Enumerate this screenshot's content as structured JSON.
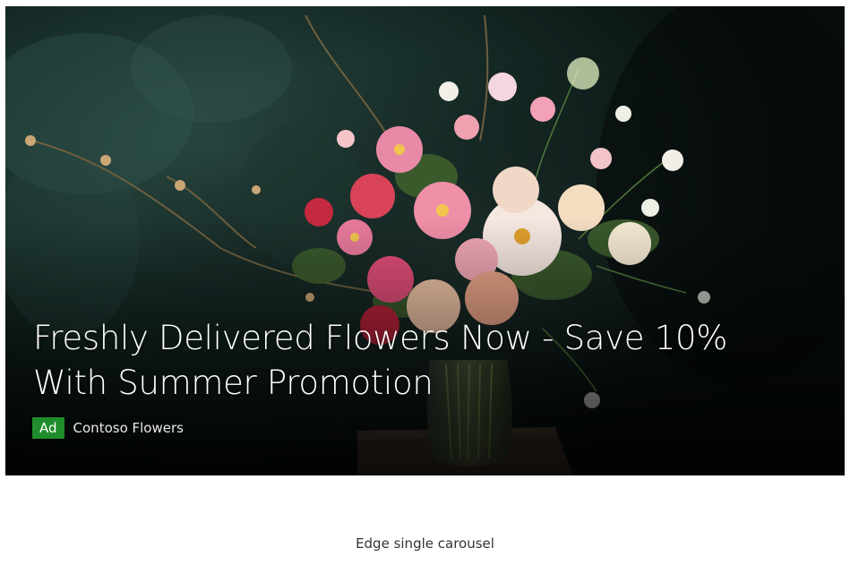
{
  "ad": {
    "headline": "Freshly Delivered Flowers Now - Save 10% With Summer Promotion",
    "badge": "Ad",
    "sponsor": "Contoso Flowers",
    "badge_color": "#1f8d2c"
  },
  "caption": "Edge single carousel"
}
